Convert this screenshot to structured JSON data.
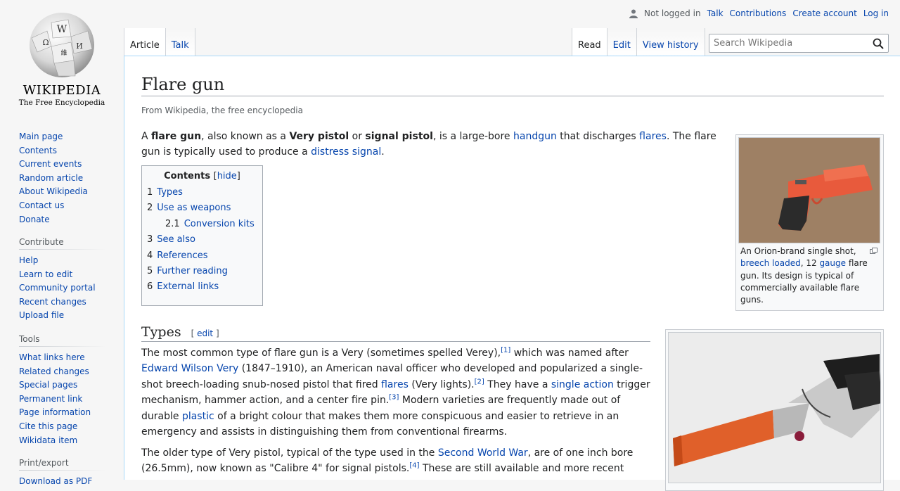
{
  "personal": {
    "status": "Not logged in",
    "talk": "Talk",
    "contributions": "Contributions",
    "create_account": "Create account",
    "login": "Log in"
  },
  "logo": {
    "wordmark": "WIKIPEDIA",
    "tagline": "The Free Encyclopedia"
  },
  "nav": {
    "main": [
      "Main page",
      "Contents",
      "Current events",
      "Random article",
      "About Wikipedia",
      "Contact us",
      "Donate"
    ],
    "contribute_heading": "Contribute",
    "contribute": [
      "Help",
      "Learn to edit",
      "Community portal",
      "Recent changes",
      "Upload file"
    ],
    "tools_heading": "Tools",
    "tools": [
      "What links here",
      "Related changes",
      "Special pages",
      "Permanent link",
      "Page information",
      "Cite this page",
      "Wikidata item"
    ],
    "print_heading": "Print/export",
    "print": [
      "Download as PDF"
    ]
  },
  "tabs": {
    "article": "Article",
    "talk": "Talk",
    "read": "Read",
    "edit": "Edit",
    "history": "View history"
  },
  "search": {
    "placeholder": "Search Wikipedia"
  },
  "article": {
    "title": "Flare gun",
    "tagline": "From Wikipedia, the free encyclopedia",
    "lead": {
      "a": "A ",
      "b1": "flare gun",
      "t1": ", also known as a ",
      "b2": "Very pistol",
      "t2": " or ",
      "b3": "signal pistol",
      "t3": ", is a large-bore ",
      "l1": "handgun",
      "t4": " that discharges ",
      "l2": "flares",
      "t5": ". The flare gun is typically used to produce a ",
      "l3": "distress signal",
      "t6": "."
    },
    "toc": {
      "title": "Contents",
      "hide": "hide",
      "items": [
        {
          "num": "1",
          "text": "Types"
        },
        {
          "num": "2",
          "text": "Use as weapons"
        },
        {
          "num": "2.1",
          "text": "Conversion kits"
        },
        {
          "num": "3",
          "text": "See also"
        },
        {
          "num": "4",
          "text": "References"
        },
        {
          "num": "5",
          "text": "Further reading"
        },
        {
          "num": "6",
          "text": "External links"
        }
      ]
    },
    "infobox": {
      "c1": "An Orion-brand single shot, ",
      "l1": "breech loaded",
      "c2": ", 12 ",
      "l2": "gauge",
      "c3": " flare gun. Its design is typical of commercially available flare guns."
    },
    "section": {
      "title": "Types",
      "edit": "edit"
    },
    "p1": {
      "t1": "The most common type of flare gun is a Very (sometimes spelled Verey),",
      "r1": "[1]",
      "t2": " which was named after ",
      "l1": "Edward Wilson Very",
      "t3": " (1847–1910), an American naval officer who developed and popularized a single-shot breech-loading snub-nosed pistol that fired ",
      "l2": "flares",
      "t4": " (Very lights).",
      "r2": "[2]",
      "t5": " They have a ",
      "l3": "single action",
      "t6": " trigger mechanism, hammer action, and a center fire pin.",
      "r3": "[3]",
      "t7": " Modern varieties are frequently made out of durable ",
      "l4": "plastic",
      "t8": " of a bright colour that makes them more conspicuous and easier to retrieve in an emergency and assists in distinguishing them from conventional firearms."
    },
    "p2": {
      "t1": "The older type of Very pistol, typical of the type used in the ",
      "l1": "Second World War",
      "t2": ", are of one inch bore (26.5mm), now known as \"Calibre 4\" for signal pistols.",
      "r1": "[4]",
      "t3": " These are still available and more recent"
    }
  }
}
